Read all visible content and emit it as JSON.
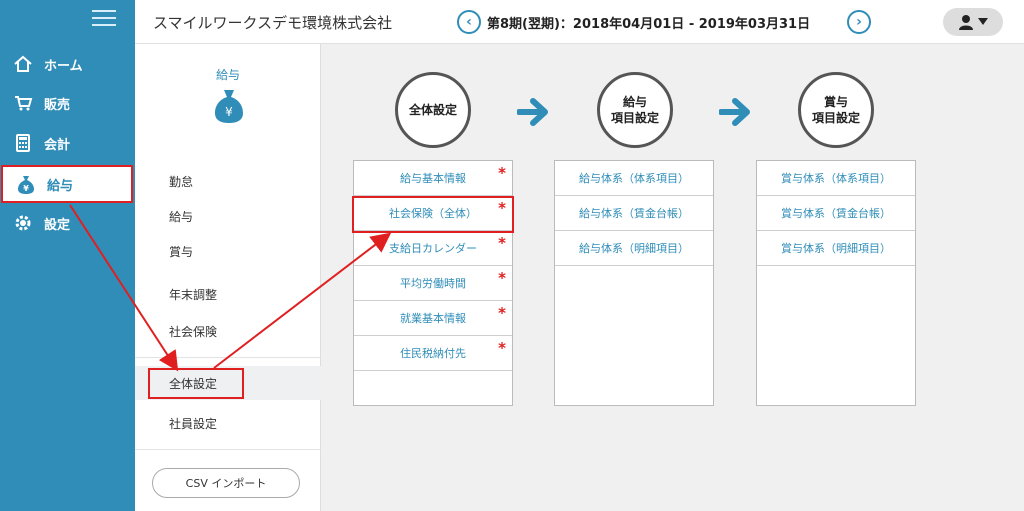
{
  "nav": {
    "items": [
      {
        "label": "ホーム",
        "icon": "home-icon"
      },
      {
        "label": "販売",
        "icon": "cart-icon"
      },
      {
        "label": "会計",
        "icon": "calculator-icon"
      },
      {
        "label": "給与",
        "icon": "yen-bag-icon"
      },
      {
        "label": "設定",
        "icon": "gear-icon"
      }
    ],
    "active_index": 3
  },
  "header": {
    "company": "スマイルワークスデモ環境株式会社",
    "period": "第8期(翌期)：2018年04月01日 - 2019年03月31日"
  },
  "submenu": {
    "title": "給与",
    "items": [
      "勤怠",
      "給与",
      "賞与",
      "年末調整",
      "社会保険",
      "全体設定",
      "社員設定"
    ],
    "active": "全体設定",
    "csv_button": "CSV インポート"
  },
  "main": {
    "steps": [
      {
        "label_line1": "全体設定",
        "label_line2": ""
      },
      {
        "label_line1": "給与",
        "label_line2": "項目設定"
      },
      {
        "label_line1": "賞与",
        "label_line2": "項目設定"
      }
    ],
    "panel1": [
      "給与基本情報",
      "社会保険（全体）",
      "支給日カレンダー",
      "平均労働時間",
      "就業基本情報",
      "住民税納付先"
    ],
    "panel2": [
      "給与体系（体系項目）",
      "給与体系（賃金台帳）",
      "給与体系（明細項目）"
    ],
    "panel3": [
      "賞与体系（体系項目）",
      "賞与体系（賃金台帳）",
      "賞与体系（明細項目）"
    ],
    "required_mark": "*"
  },
  "colors": {
    "accent": "#2f8db8",
    "highlight": "#e02020"
  }
}
